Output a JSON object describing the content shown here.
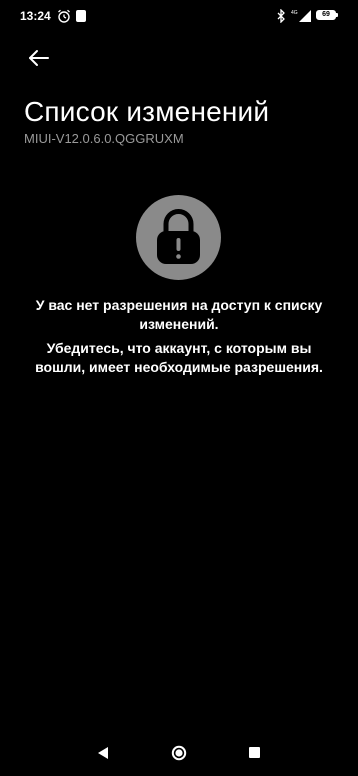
{
  "status_bar": {
    "time": "13:24",
    "battery": "69",
    "icons": [
      "alarm-icon",
      "notification-icon",
      "bluetooth-icon",
      "signal-icon",
      "battery-icon"
    ]
  },
  "header": {
    "back_icon": "arrow-left-icon",
    "title": "Список изменений",
    "version": "MIUI-V12.0.6.0.QGGRUXM"
  },
  "error": {
    "icon": "lock-icon",
    "line1": "У вас нет разрешения на доступ к списку изменений.",
    "line2": "Убедитесь, что аккаунт, с которым вы вошли, имеет необходимые разрешения."
  },
  "nav_bar": {
    "icons": [
      "nav-back-icon",
      "nav-home-icon",
      "nav-recents-icon"
    ]
  },
  "colors": {
    "background": "#000000",
    "text": "#ffffff",
    "secondary_text": "#9a9a9a",
    "lock_circle": "#8a8a8a"
  }
}
